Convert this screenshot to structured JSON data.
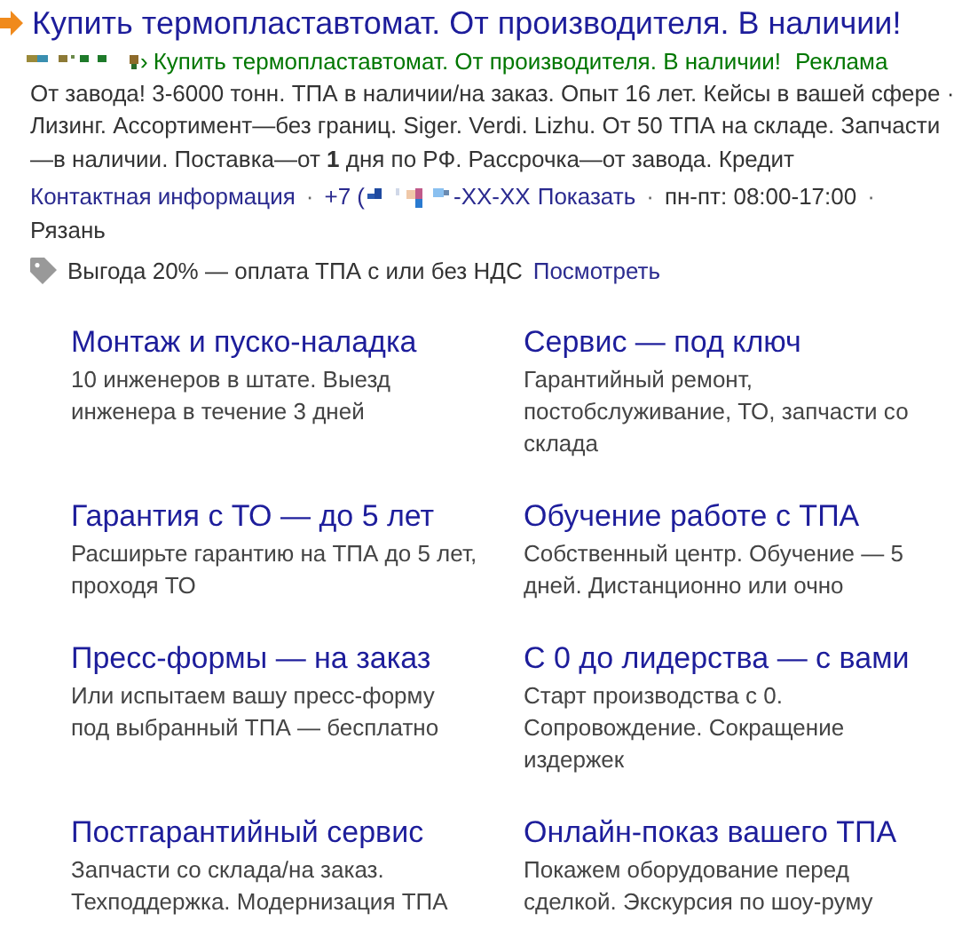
{
  "ad": {
    "title": "Купить термопластавтомат. От производителя. В наличии!",
    "breadcrumb_separator": "›",
    "breadcrumb": "Купить термопластавтомат. От производителя. В наличии!",
    "ad_label": "Реклама",
    "description": "От завода! 3-6000 тонн. ТПА в наличии/на заказ. Опыт 16 лет. Кейсы в вашей сфере · Лизинг. Ассортимент—без границ. Siger. Verdi. Lizhu. От 50 ТПА на складе. Запчасти—в наличии. Поставка—от **1** дня по РФ. Рассрочка—от завода. Кредит"
  },
  "contacts": [
    {
      "kind": "link",
      "text": "Контактная информация"
    },
    {
      "kind": "separator",
      "text": "·"
    },
    {
      "kind": "phone",
      "prefix": "+7 (",
      "suffix": "-XX-XX",
      "action": "Показать"
    },
    {
      "kind": "separator",
      "text": "·"
    },
    {
      "kind": "text",
      "text": "пн-пт: 08:00-17:00"
    },
    {
      "kind": "separator",
      "text": "·"
    },
    {
      "kind": "text",
      "text": "Рязань"
    }
  ],
  "promo": {
    "text": "Выгода 20% — оплата ТПА с или без НДС",
    "link": "Посмотреть"
  },
  "sitelinks": [
    {
      "title": "Монтаж и пуско-наладка",
      "description": "10 инженеров в штате. Выезд инженера в течение 3 дней"
    },
    {
      "title": "Сервис — под ключ",
      "description": "Гарантийный ремонт, постобслуживание, ТО, запчасти со склада"
    },
    {
      "title": "Гарантия с ТО — до 5 лет",
      "description": "Расширьте гарантию на ТПА до 5 лет, проходя ТО"
    },
    {
      "title": "Обучение работе с ТПА",
      "description": "Собственный центр. Обучение — 5 дней. Дистанционно или очно"
    },
    {
      "title": "Пресс-формы — на заказ",
      "description": "Или испытаем вашу пресс-форму под выбранный ТПА — бесплатно"
    },
    {
      "title": "С 0 до лидерства — с вами",
      "description": "Старт производства с 0. Сопровождение. Сокращение издержек"
    },
    {
      "title": "Постгарантийный сервис",
      "description": "Запчасти со склада/на заказ. Техподдержка. Модернизация ТПА"
    },
    {
      "title": "Онлайн-показ вашего ТПА",
      "description": "Покажем оборудование перед сделкой. Экскурсия по шоу-руму"
    }
  ]
}
